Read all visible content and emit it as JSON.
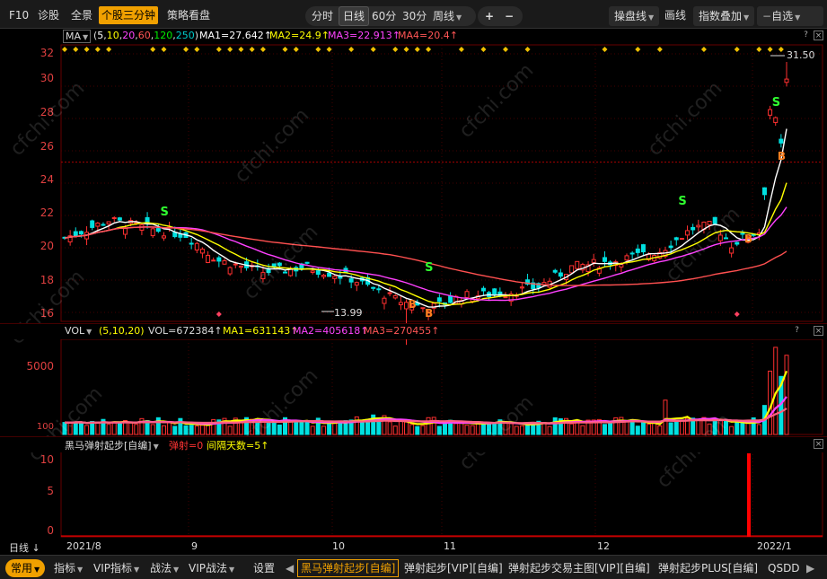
{
  "toolbar": {
    "f10": "F10",
    "diagnose": "诊股",
    "full_view": "全景",
    "three_minute": "个股三分钟",
    "strategy": "策略看盘",
    "periods": [
      "分时",
      "日线",
      "60分",
      "30分"
    ],
    "week_dropdown": "周线",
    "plus": "+",
    "minus": "−",
    "trade_line": "操盘线",
    "draw_line": "画线",
    "index_overlay": "指数叠加",
    "self_select": "自选"
  },
  "main_pane": {
    "indicator_name": "MA",
    "params_prefix": "(",
    "params": [
      "5",
      "10",
      "20",
      "60",
      "120",
      "250"
    ],
    "params_suffix": ")",
    "ma_values": [
      "MA1=27.642↑",
      "MA2=24.9↑",
      "MA3=22.913↑",
      "MA4=20.4↑"
    ],
    "y_ticks": [
      "32",
      "30",
      "28",
      "26",
      "24",
      "22",
      "20",
      "18",
      "16"
    ],
    "high_label": "31.50",
    "low_label": "13.99",
    "signal_labels": {
      "sell": "S",
      "buy": "B"
    },
    "ctl_help": "?",
    "ctl_close": "×"
  },
  "vol_pane": {
    "indicator_name": "VOL",
    "params_text": "(5,10,20)",
    "vol_value": "VOL=672384↑",
    "ma_values": [
      "MA1=631143↑",
      "MA2=405618↑",
      "MA3=270455↑"
    ],
    "y_ticks": [
      "5000",
      "100"
    ],
    "ctl_help": "?",
    "ctl_close": "×"
  },
  "signal_pane": {
    "indicator_name": "黑马弹射起步[自编]",
    "shoot_value": "弹射=0",
    "interval_value": "间隔天数=5↑",
    "y_ticks": [
      "10",
      "5",
      "0"
    ],
    "ctl_close": "×"
  },
  "x_axis": {
    "period_label": "日线",
    "months": [
      "2021/8",
      "9",
      "10",
      "11",
      "12",
      "2022/1"
    ]
  },
  "bottom_bar": {
    "common": "常用",
    "indicators": "指标",
    "vip_indicators": "VIP指标",
    "tactics": "战法",
    "vip_tactics": "VIP战法",
    "settings": "设置",
    "tabs": [
      "黑马弹射起步[自编]",
      "弹射起步[VIP][自编]",
      "弹射起步交易主图[VIP][自编]",
      "弹射起步PLUS[自编]",
      "QSDD"
    ]
  },
  "watermark": "cfchi.com",
  "colors": {
    "up": "#ff3030",
    "down": "#00e0e0",
    "ma1": "#ffffff",
    "ma2": "#ffff00",
    "ma3": "#ff40ff",
    "ma4": "#ff5050",
    "accent": "#f0a000"
  }
}
